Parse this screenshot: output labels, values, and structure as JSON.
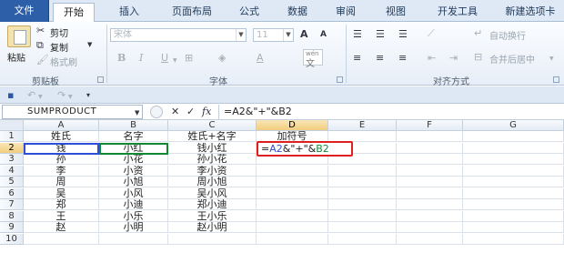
{
  "tabs": [
    "文件",
    "开始",
    "插入",
    "页面布局",
    "公式",
    "数据",
    "审阅",
    "视图",
    "开发工具",
    "新建选项卡"
  ],
  "clipboard": {
    "paste": "粘贴",
    "cut": "剪切",
    "copy": "复制",
    "format_painter": "格式刷",
    "group": "剪贴板"
  },
  "font": {
    "name_placeholder": "宋体",
    "size": "11",
    "bold": "B",
    "italic": "I",
    "underline": "U",
    "grow": "A",
    "shrink": "A",
    "group": "字体",
    "phonetic": "wén"
  },
  "alignment": {
    "wrap_text": "自动换行",
    "merge_center": "合并后居中",
    "group": "对齐方式"
  },
  "namebox": "SUMPRODUCT",
  "formula_bar": {
    "cancel": "✕",
    "enter": "✓",
    "fx": "fx",
    "formula": "=A2&\"+\"&B2"
  },
  "columns": [
    "A",
    "B",
    "C",
    "D",
    "E",
    "F",
    "G"
  ],
  "rows": [
    "1",
    "2",
    "3",
    "4",
    "5",
    "6",
    "7",
    "8",
    "9",
    "10"
  ],
  "table": {
    "headers": [
      "姓氏",
      "名字",
      "姓氏+名字",
      "加符号"
    ],
    "surnames": [
      "钱",
      "孙",
      "李",
      "周",
      "吴",
      "郑",
      "王",
      "赵"
    ],
    "given_names": [
      "小红",
      "小花",
      "小资",
      "小旭",
      "小风",
      "小迪",
      "小乐",
      "小明"
    ],
    "full_names": [
      "钱小红",
      "孙小花",
      "李小资",
      "周小旭",
      "吴小风",
      "郑小迪",
      "王小乐",
      "赵小明"
    ]
  },
  "editing_cell": {
    "eq": "=",
    "ref1": "A2",
    "mid": "&\"+\"&",
    "ref2": "B2"
  },
  "colors": {
    "file_tab": "#2c5fa8",
    "ref_a": "#2b4fd8",
    "ref_b": "#0f8a33",
    "edit_border": "#e02020",
    "selected_header": "#f1cd7d"
  }
}
